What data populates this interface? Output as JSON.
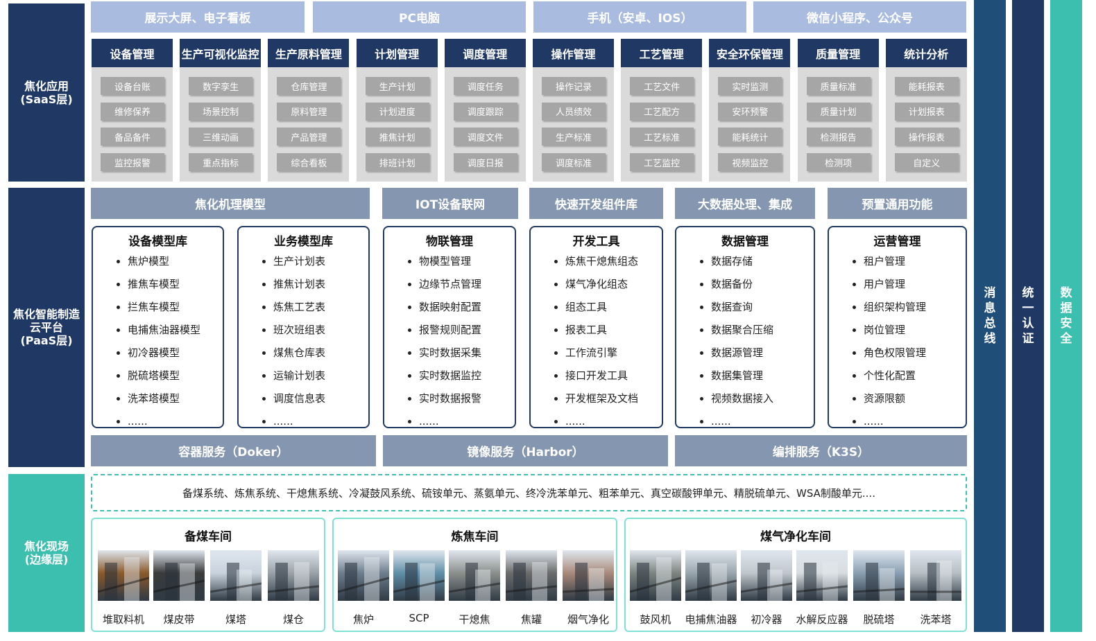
{
  "layers": {
    "saas": "焦化应用\n(SaaS层)",
    "paas": "焦化智能制造\n云平台\n(PaaS层)",
    "edge": "焦化现场\n(边缘层)"
  },
  "side_bars": [
    "消息总线",
    "统一认证",
    "数据安全"
  ],
  "devices": [
    "展示大屏、电子看板",
    "PC电脑",
    "手机（安卓、IOS）",
    "微信小程序、公众号"
  ],
  "saas_modules": [
    {
      "title": "设备管理",
      "items": [
        "设备台账",
        "维修保养",
        "备品备件",
        "监控报警"
      ]
    },
    {
      "title": "生产可视化监控",
      "items": [
        "数字孪生",
        "场景控制",
        "三维动画",
        "重点指标"
      ]
    },
    {
      "title": "生产原料管理",
      "items": [
        "仓库管理",
        "原料管理",
        "产品管理",
        "综合看板"
      ]
    },
    {
      "title": "计划管理",
      "items": [
        "生产计划",
        "计划进度",
        "推焦计划",
        "排班计划"
      ]
    },
    {
      "title": "调度管理",
      "items": [
        "调度任务",
        "调度跟踪",
        "调度文件",
        "调度日报"
      ]
    },
    {
      "title": "操作管理",
      "items": [
        "操作记录",
        "人员绩效",
        "生产标准",
        "调度标准"
      ]
    },
    {
      "title": "工艺管理",
      "items": [
        "工艺文件",
        "工艺配方",
        "工艺标准",
        "工艺监控"
      ]
    },
    {
      "title": "安全环保管理",
      "items": [
        "实时监测",
        "安环预警",
        "能耗统计",
        "视频监控"
      ]
    },
    {
      "title": "质量管理",
      "items": [
        "质量标准",
        "质量计划",
        "检测报告",
        "检测项"
      ]
    },
    {
      "title": "统计分析",
      "items": [
        "能耗报表",
        "计划报表",
        "操作报表",
        "自定义"
      ]
    }
  ],
  "paas_headers": [
    "焦化机理模型",
    "IOT设备联网",
    "快速开发组件库",
    "大数据处理、集成",
    "预置通用功能"
  ],
  "paas_boxes": [
    {
      "title": "设备模型库",
      "items": [
        "焦炉模型",
        "推焦车模型",
        "拦焦车模型",
        "电捕焦油器模型",
        "初冷器模型",
        "脱硫塔模型",
        "洗苯塔模型",
        "......"
      ]
    },
    {
      "title": "业务模型库",
      "items": [
        "生产计划表",
        "推焦计划表",
        "炼焦工艺表",
        "班次班组表",
        "煤焦仓库表",
        "运输计划表",
        "调度信息表",
        "......"
      ]
    },
    {
      "title": "物联管理",
      "items": [
        "物模型管理",
        "边缘节点管理",
        "数据映射配置",
        "报警规则配置",
        "实时数据采集",
        "实时数据监控",
        "实时数据报警",
        "......"
      ]
    },
    {
      "title": "开发工具",
      "items": [
        "炼焦干熄焦组态",
        "煤气净化组态",
        "组态工具",
        "报表工具",
        "工作流引擎",
        "接口开发工具",
        "开发框架及文档",
        "......"
      ]
    },
    {
      "title": "数据管理",
      "items": [
        "数据存储",
        "数据备份",
        "数据查询",
        "数据聚合压缩",
        "数据源管理",
        "数据集管理",
        "视频数据接入",
        "......"
      ]
    },
    {
      "title": "运营管理",
      "items": [
        "租户管理",
        "用户管理",
        "组织架构管理",
        "岗位管理",
        "角色权限管理",
        "个性化配置",
        "资源限额",
        "......"
      ]
    }
  ],
  "services": [
    "容器服务（Doker）",
    "镜像服务（Harbor）",
    "编排服务（K3S）"
  ],
  "systems_line": "备煤系统、炼焦系统、干熄焦系统、冷凝鼓风系统、硫铵单元、蒸氨单元、终冷洗苯单元、粗苯单元、真空碳酸钾单元、精脱硫单元、WSA制酸单元....",
  "workshops": [
    {
      "title": "备煤车间",
      "equipment": [
        "堆取料机",
        "煤皮带",
        "煤塔",
        "煤仓"
      ]
    },
    {
      "title": "炼焦车间",
      "equipment": [
        "焦炉",
        "SCP",
        "干熄焦",
        "焦罐",
        "烟气净化"
      ]
    },
    {
      "title": "煤气净化车间",
      "equipment": [
        "鼓风机",
        "电捕焦油器",
        "初冷器",
        "水解反应器",
        "脱硫塔",
        "洗苯塔"
      ]
    }
  ],
  "colors": {
    "navy": "#1f3864",
    "teal": "#3cbfae",
    "device": "#a9bbde",
    "paas_head": "#8496b0"
  }
}
